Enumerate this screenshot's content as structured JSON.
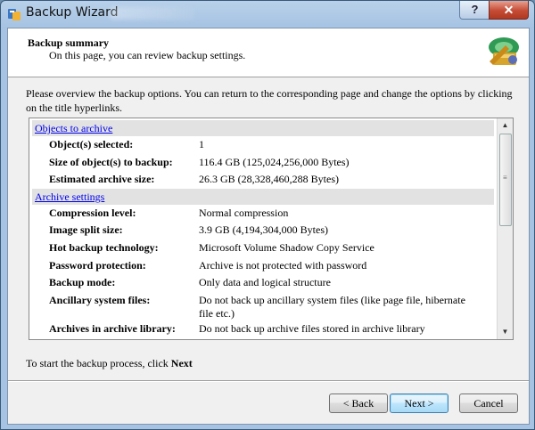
{
  "window": {
    "title": "Backup Wizard",
    "help_label": "?",
    "close_label": "✕"
  },
  "header": {
    "title": "Backup summary",
    "subtitle": "On this page, you can review backup settings."
  },
  "intro": "Please overview the backup options. You can return to the corresponding page and change the options by clicking on the title hyperlinks.",
  "sections": [
    {
      "title": "Objects to archive",
      "rows": [
        {
          "label": "Object(s) selected:",
          "value": "1"
        },
        {
          "label": "Size of object(s) to backup:",
          "value": "116.4 GB (125,024,256,000 Bytes)"
        },
        {
          "label": "Estimated archive size:",
          "value": "26.3 GB (28,328,460,288 Bytes)"
        }
      ]
    },
    {
      "title": "Archive settings",
      "rows": [
        {
          "label": "Compression level:",
          "value": "Normal compression"
        },
        {
          "label": "Image split size:",
          "value": "3.9 GB (4,194,304,000 Bytes)"
        },
        {
          "label": "Hot backup technology:",
          "value": "Microsoft Volume Shadow Copy Service"
        },
        {
          "label": "Password protection:",
          "value": "Archive is not protected with password"
        },
        {
          "label": "Backup mode:",
          "value": "Only data and logical structure"
        },
        {
          "label": "Ancillary system files:",
          "value": "Do not back up ancillary system files (like page file, hibernate file etc.)"
        },
        {
          "label": "Archives in archive library:",
          "value": "Do not back up archive files stored in archive library"
        }
      ]
    }
  ],
  "footer": {
    "text_prefix": "To start the backup process, click ",
    "text_bold": "Next"
  },
  "buttons": {
    "back": "< Back",
    "next": "Next >",
    "cancel": "Cancel"
  },
  "colors": {
    "link": "#0000ee",
    "section_bg": "#e2e2e2",
    "close_button": "#c54b35"
  }
}
